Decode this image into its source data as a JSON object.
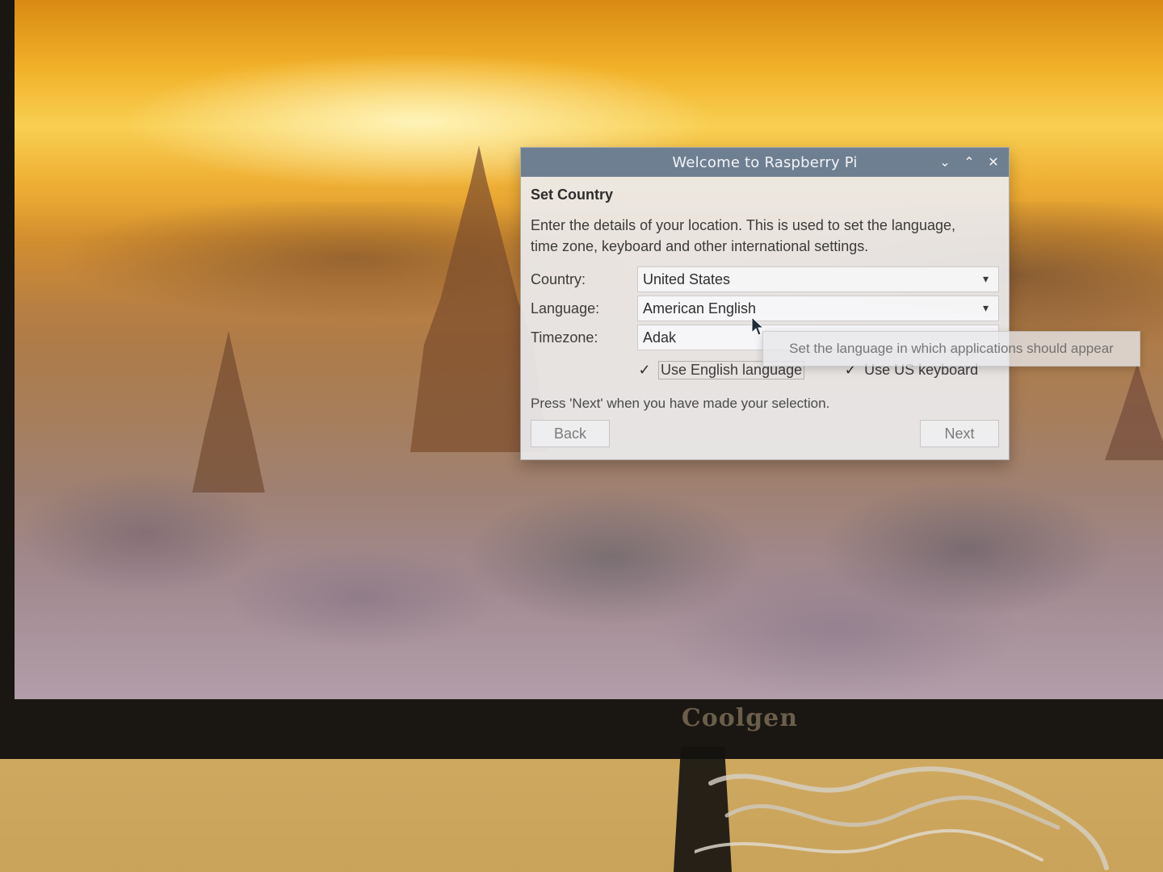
{
  "window": {
    "title": "Welcome to Raspberry Pi",
    "buttons": {
      "minimize_icon": "chevron-down-icon",
      "maximize_icon": "chevron-up-icon",
      "close_icon": "close-icon"
    }
  },
  "dialog": {
    "heading": "Set Country",
    "description_line1": "Enter the details of your location. This is used to set the language,",
    "description_line2": "time zone, keyboard and other international settings.",
    "fields": {
      "country_label": "Country:",
      "country_value": "United States",
      "language_label": "Language:",
      "language_value": "American English",
      "timezone_label": "Timezone:",
      "timezone_value": "Adak"
    },
    "checkboxes": {
      "use_english_language": "Use English language",
      "use_us_keyboard": "Use US keyboard"
    },
    "hint": "Press 'Next' when you have made your selection.",
    "buttons": {
      "back": "Back",
      "next": "Next"
    }
  },
  "tooltip": {
    "text": "Set the language in which applications should appear"
  },
  "monitor": {
    "brand": "Coolgen"
  }
}
